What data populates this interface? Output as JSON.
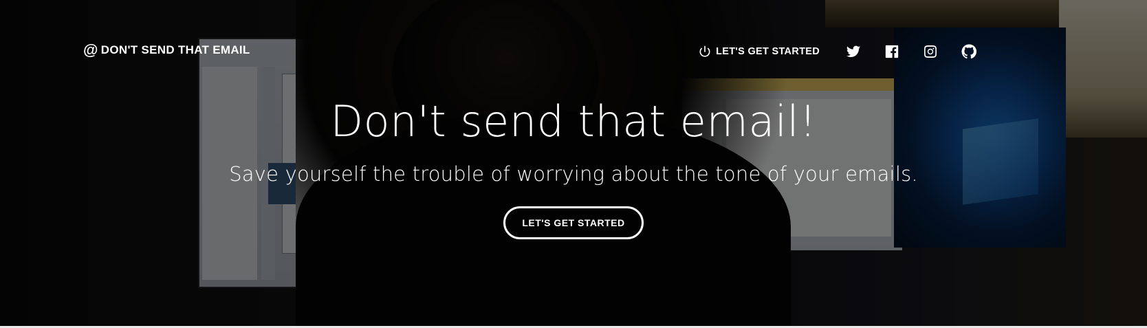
{
  "brand": {
    "symbol": "@",
    "name": "DON'T SEND THAT EMAIL"
  },
  "nav": {
    "start_label": "LET'S GET STARTED",
    "start_icon": "power-icon",
    "social": [
      {
        "name": "twitter-icon"
      },
      {
        "name": "facebook-icon"
      },
      {
        "name": "instagram-icon"
      },
      {
        "name": "github-icon"
      }
    ]
  },
  "hero": {
    "headline": "Don't send that email!",
    "subheading": "Save yourself the trouble of worrying about the tone of your emails.",
    "cta_label": "LET'S GET STARTED"
  },
  "colors": {
    "text": "#ffffff",
    "overlay": "#000000"
  }
}
